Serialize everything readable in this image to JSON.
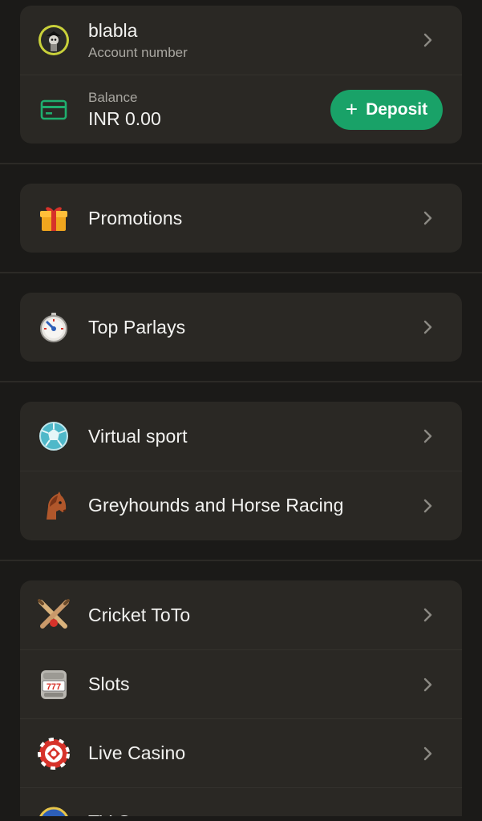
{
  "account": {
    "username": "blabla",
    "subtitle": "Account number",
    "balance_label": "Balance",
    "balance_value": "INR 0.00",
    "deposit_label": "Deposit",
    "avatar_icon": "pirate-avatar-icon",
    "wallet_icon": "wallet-icon"
  },
  "menu": {
    "promotions": "Promotions",
    "top_parlays": "Top Parlays",
    "virtual_sport": "Virtual sport",
    "greyhounds": "Greyhounds and Horse Racing",
    "cricket_toto": "Cricket ToTo",
    "slots": "Slots",
    "live_casino": "Live Casino",
    "partial_item": "TV G..."
  },
  "colors": {
    "background": "#1b1a18",
    "card": "#2a2824",
    "accent_green": "#19a268",
    "text_primary": "#f2f2f0",
    "text_secondary": "#a9a7a1"
  }
}
